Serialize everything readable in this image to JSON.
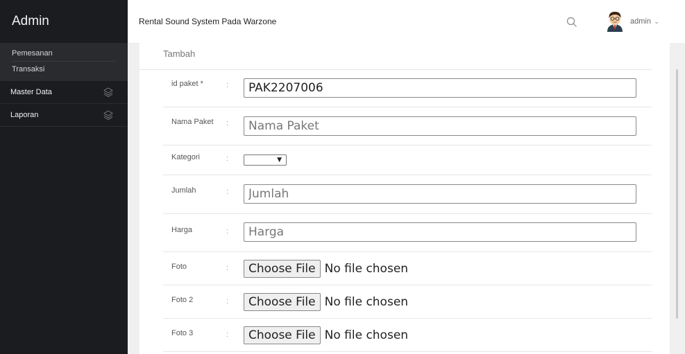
{
  "sidebar": {
    "brand": "Admin",
    "submenu": [
      "Pemesanan",
      "Transaksi"
    ],
    "menu": [
      {
        "label": "Master Data",
        "icon": "layers-icon"
      },
      {
        "label": "Laporan",
        "icon": "layers-icon"
      }
    ]
  },
  "header": {
    "title": "Rental Sound System Pada Warzone",
    "user": "admin"
  },
  "form": {
    "title": "Tambah",
    "colon": ":",
    "id_paket": {
      "label": "id paket *",
      "value": "PAK2207006"
    },
    "nama_paket": {
      "label": "Nama Paket",
      "placeholder": "Nama Paket"
    },
    "kategori": {
      "label": "Kategori",
      "value": ""
    },
    "jumlah": {
      "label": "Jumlah",
      "placeholder": "Jumlah"
    },
    "harga": {
      "label": "Harga",
      "placeholder": "Harga"
    },
    "foto": {
      "label": "Foto",
      "button": "Choose File",
      "status": "No file chosen"
    },
    "foto2": {
      "label": "Foto 2",
      "button": "Choose File",
      "status": "No file chosen"
    },
    "foto3": {
      "label": "Foto 3",
      "button": "Choose File",
      "status": "No file chosen"
    }
  }
}
